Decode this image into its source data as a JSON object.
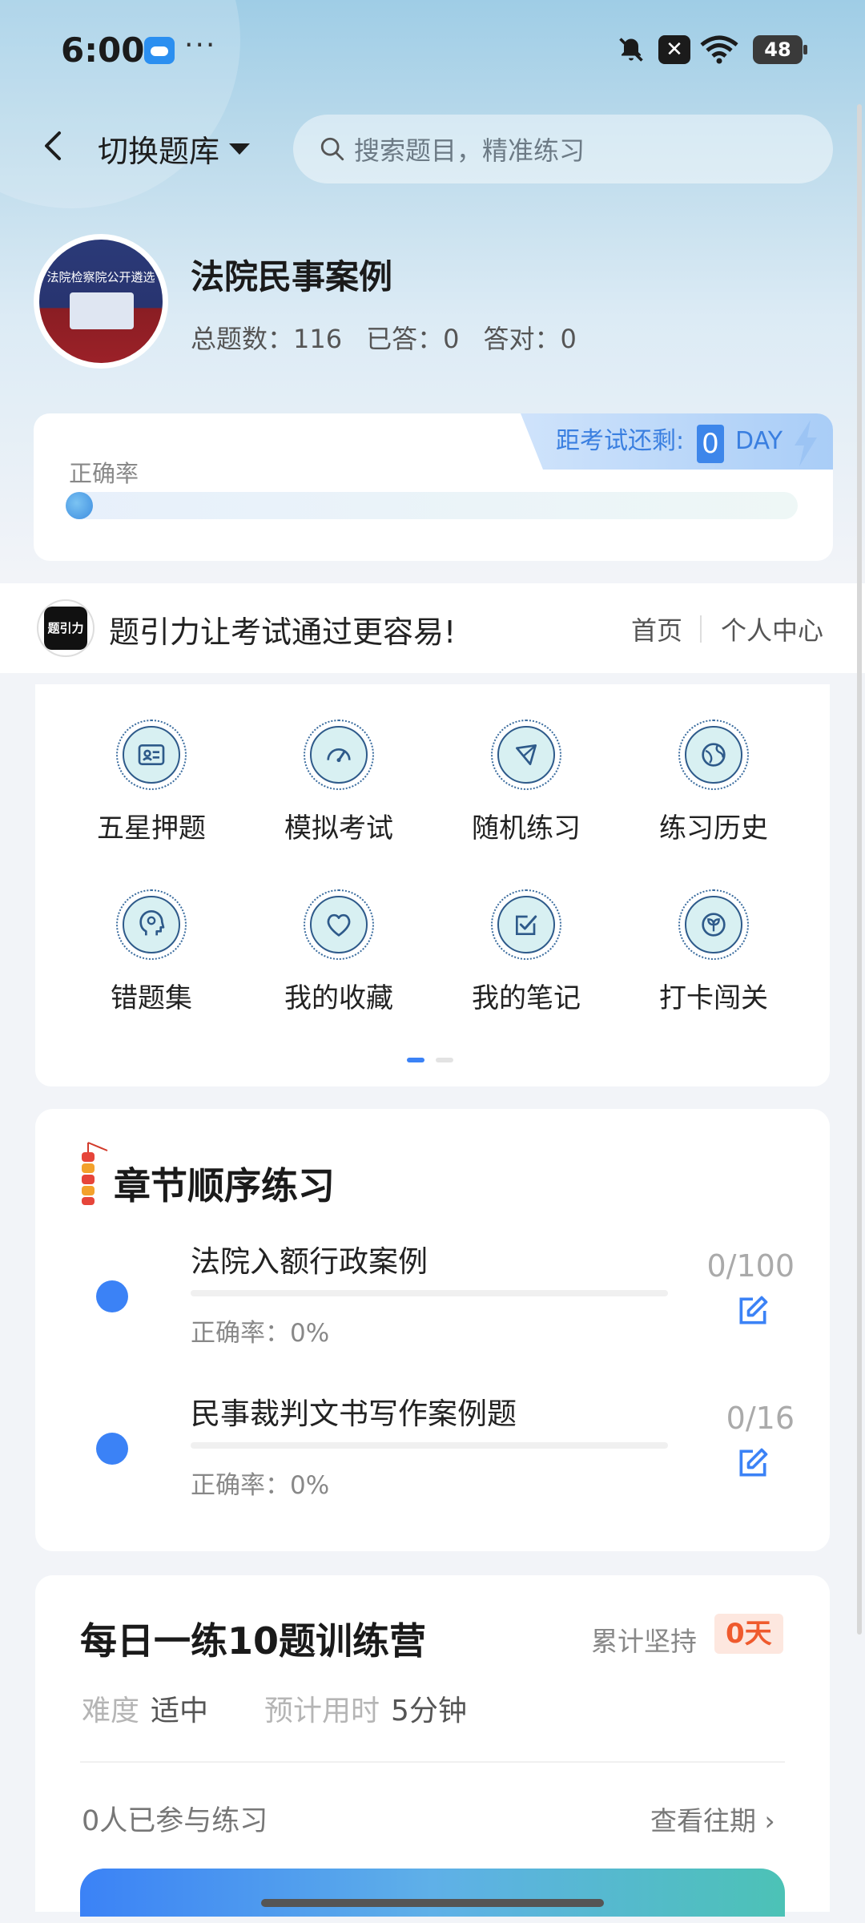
{
  "status_bar": {
    "time": "6:00",
    "dots": "···",
    "battery": "48"
  },
  "header": {
    "switch_label": "切换题库",
    "search_placeholder": "搜索题目，精准练习"
  },
  "bank": {
    "title": "法院民事案例",
    "avatar_text": "法院检察院公开遴选",
    "stats": {
      "total": "总题数：116",
      "answered": "已答：0",
      "correct": "答对：0"
    }
  },
  "accuracy_card": {
    "exam_label": "距考试还剩:",
    "exam_days": "0",
    "exam_unit": "DAY",
    "accuracy_label": "正确率",
    "accuracy_value": 0
  },
  "brand_bar": {
    "logo_text": "题引力",
    "slogan": "题引力让考试通过更容易!",
    "home": "首页",
    "personal_center": "个人中心"
  },
  "grid": {
    "items": [
      {
        "label": "五星押题",
        "icon": "id-card-icon"
      },
      {
        "label": "模拟考试",
        "icon": "speedometer-icon"
      },
      {
        "label": "随机练习",
        "icon": "shuffle-icon"
      },
      {
        "label": "练习历史",
        "icon": "globe-icon"
      },
      {
        "label": "错题集",
        "icon": "head-icon"
      },
      {
        "label": "我的收藏",
        "icon": "heart-icon"
      },
      {
        "label": "我的笔记",
        "icon": "note-check-icon"
      },
      {
        "label": "打卡闯关",
        "icon": "sprout-icon"
      }
    ],
    "pages": 2,
    "active_page": 1
  },
  "chapter": {
    "title": "章节顺序练习",
    "items": [
      {
        "name": "法院入额行政案例",
        "accuracy": "正确率：0%",
        "count": "0/100",
        "progress": 0
      },
      {
        "name": "民事裁判文书写作案例题",
        "accuracy": "正确率：0%",
        "count": "0/16",
        "progress": 0
      }
    ]
  },
  "daily": {
    "title": "每日一练10题训练营",
    "persist_label": "累计坚持",
    "persist_days": "0天",
    "difficulty_label": "难度",
    "difficulty_value": "适中",
    "time_label": "预计用时",
    "time_value": "5分钟",
    "participants": "0人已参与练习",
    "history": "查看往期 ›"
  },
  "colors": {
    "accent": "#3b82f6",
    "badge_text": "#ef5a2d",
    "badge_bg": "#fde7df"
  }
}
